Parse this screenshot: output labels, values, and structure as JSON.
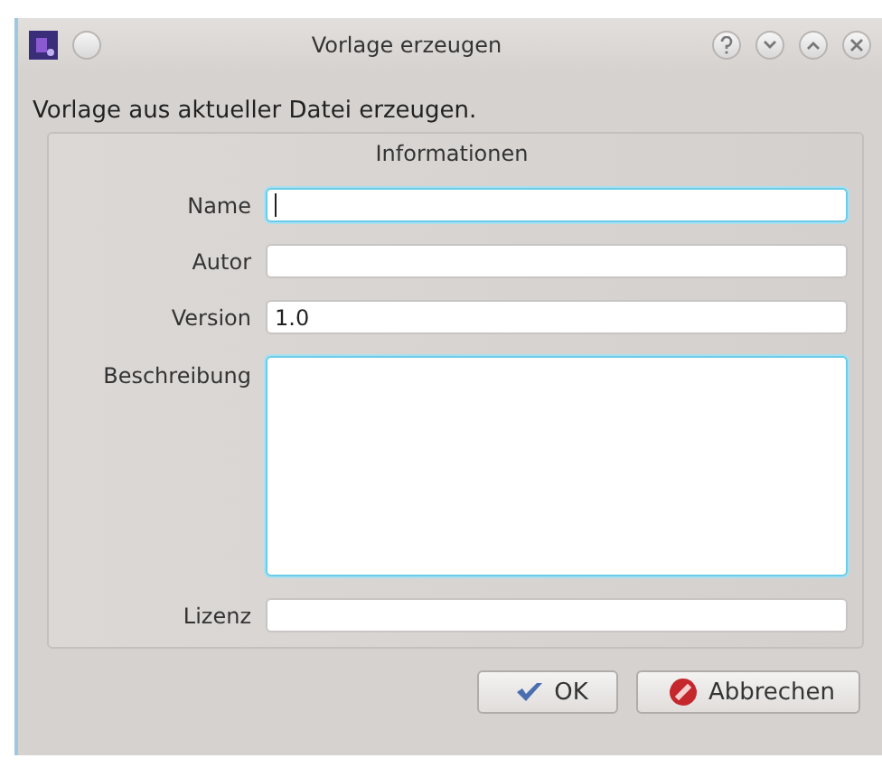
{
  "window": {
    "title": "Vorlage erzeugen"
  },
  "subtitle": "Vorlage aus aktueller Datei erzeugen.",
  "group": {
    "title": "Informationen",
    "fields": [
      {
        "label": "Name",
        "kind": "line",
        "focused": true
      },
      {
        "label": "Autor",
        "kind": "line",
        "focused": false
      },
      {
        "label": "Version",
        "kind": "line",
        "value": "1.0",
        "focused": false
      },
      {
        "label": "Beschreibung",
        "kind": "multiline",
        "focused": true
      },
      {
        "label": "Lizenz",
        "kind": "line",
        "focused": false
      }
    ]
  },
  "buttons": [
    {
      "label": "OK",
      "kind": "ok"
    },
    {
      "label": "Abbrechen",
      "kind": "cancel"
    }
  ]
}
